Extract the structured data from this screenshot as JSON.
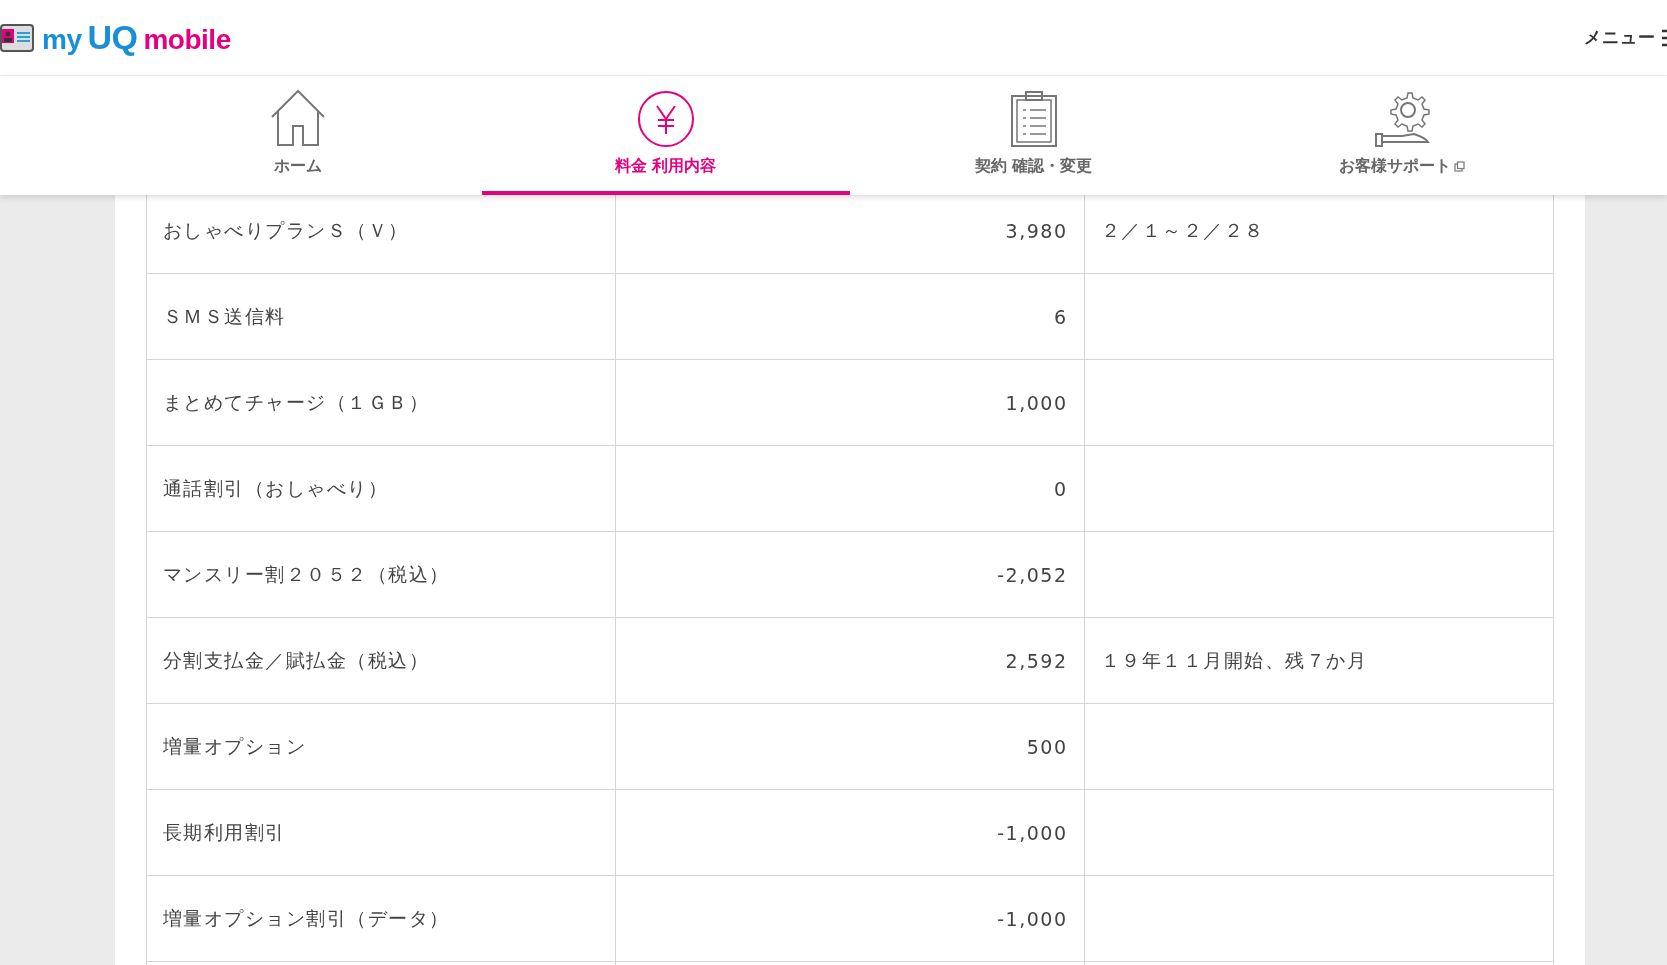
{
  "header": {
    "logo": {
      "my": "my",
      "brand": "UQ",
      "product": "mobile"
    },
    "menu_label": "メニュー"
  },
  "nav_tabs": [
    {
      "label": "ホーム",
      "kind": "home",
      "selected": false,
      "external": false
    },
    {
      "label": "料金 利用内容",
      "kind": "yen",
      "selected": true,
      "external": false
    },
    {
      "label": "契約 確認・変更",
      "kind": "clipboard",
      "selected": false,
      "external": false
    },
    {
      "label": "お客様サポート",
      "kind": "support",
      "selected": false,
      "external": true
    }
  ],
  "table": {
    "rows": [
      {
        "item": "おしゃべりプランＳ（Ｖ）",
        "amount": "3,980",
        "note": "２／１～２／２８"
      },
      {
        "item": "ＳＭＳ送信料",
        "amount": "6"
      },
      {
        "item": "まとめてチャージ（１ＧＢ）",
        "amount": "1,000"
      },
      {
        "item": "通話割引（おしゃべり）",
        "amount": "0"
      },
      {
        "item": "マンスリー割２０５２（税込）",
        "amount": "-2,052"
      },
      {
        "item": "分割支払金／賦払金（税込）",
        "amount": "2,592",
        "note": "１９年１１月開始、残７か月"
      },
      {
        "item": "増量オプション",
        "amount": "500"
      },
      {
        "item": "長期利用割引",
        "amount": "-1,000"
      },
      {
        "item": "増量オプション割引（データ）",
        "amount": "-1,000"
      }
    ]
  }
}
